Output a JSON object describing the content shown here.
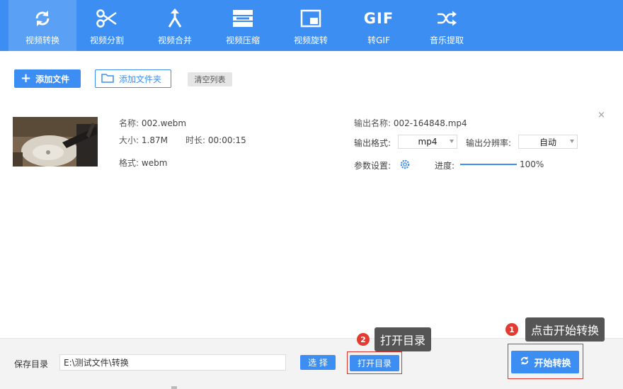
{
  "toolbar": {
    "tabs": [
      {
        "label": "视频转换",
        "icon": "refresh-icon"
      },
      {
        "label": "视频分割",
        "icon": "scissors-icon"
      },
      {
        "label": "视频合并",
        "icon": "merge-icon"
      },
      {
        "label": "视频压缩",
        "icon": "compress-icon"
      },
      {
        "label": "视频旋转",
        "icon": "rotate-icon"
      },
      {
        "label": "转GIF",
        "icon": "gif-icon"
      },
      {
        "label": "音乐提取",
        "icon": "shuffle-icon"
      }
    ],
    "gif_glyph": "GIF"
  },
  "actions": {
    "add_file": "添加文件",
    "add_folder": "添加文件夹",
    "clear_list": "清空列表"
  },
  "file": {
    "name_label": "名称:",
    "name": "002.webm",
    "size_label": "大小:",
    "size": "1.87M",
    "duration_label": "时长:",
    "duration": "00:00:15",
    "format_label": "格式:",
    "format": "webm",
    "output_name_label": "输出名称:",
    "output_name": "002-164848.mp4",
    "output_format_label": "输出格式:",
    "output_format": "mp4",
    "output_resolution_label": "输出分辨率:",
    "output_resolution": "自动",
    "params_label": "参数设置:",
    "progress_label": "进度:",
    "progress_text": "100%",
    "progress": 1.0
  },
  "bottom": {
    "save_dir_label": "保存目录",
    "save_dir": "E:\\测试文件\\转换",
    "choose": "选 择",
    "open_dir": "打开目录",
    "start": "开始转换"
  },
  "annotations": {
    "step1_num": "1",
    "step1_tip": "点击开始转换",
    "step2_num": "2",
    "step2_tip": "打开目录"
  },
  "colors": {
    "accent": "#3d8ef3",
    "annotation_red": "#e33a32",
    "tooltip_bg": "#555555"
  }
}
